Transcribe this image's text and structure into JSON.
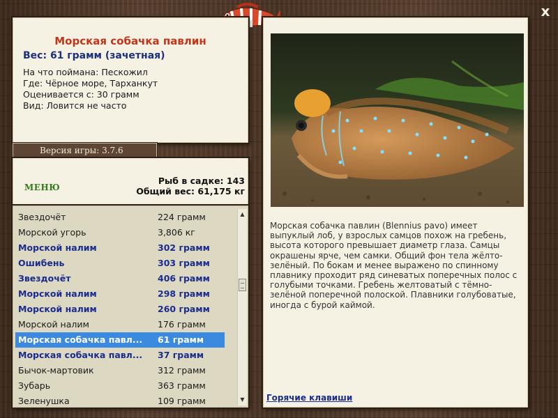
{
  "fish": {
    "name": "Морская собачка павлин",
    "weight_line": "Вес: 61 грамм (зачетная)",
    "bait": "На что поймана: Пескожил",
    "location": "Где: Чёрное море, Тарханкут",
    "rated_from": "Оценивается с: 30 грамм",
    "frequency": "Вид: Ловится не часто"
  },
  "version_label": "Версия игры: 3.7.6",
  "menu_label": "МЕНЮ",
  "cage": {
    "count_line": "Рыб в садке: 143",
    "total_line": "Общий вес: 61,175 кг"
  },
  "list": [
    {
      "name": "Звездочёт",
      "weight": "224 грамм",
      "style": "normal"
    },
    {
      "name": "Морской угорь",
      "weight": "3,806 кг",
      "style": "normal"
    },
    {
      "name": "Морской налим",
      "weight": "302 грамм",
      "style": "bold"
    },
    {
      "name": "Ошибень",
      "weight": "303 грамм",
      "style": "bold"
    },
    {
      "name": "Звездочёт",
      "weight": "406 грамм",
      "style": "bold"
    },
    {
      "name": "Морской налим",
      "weight": "298 грамм",
      "style": "bold"
    },
    {
      "name": "Морской налим",
      "weight": "260 грамм",
      "style": "bold"
    },
    {
      "name": "Морской налим",
      "weight": "176 грамм",
      "style": "normal"
    },
    {
      "name": "Морская собачка павл...",
      "weight": "61 грамм",
      "style": "selected"
    },
    {
      "name": "Морская собачка павл...",
      "weight": "37 грамм",
      "style": "bold"
    },
    {
      "name": "Бычок-мартовик",
      "weight": "312 грамм",
      "style": "normal"
    },
    {
      "name": "Зубарь",
      "weight": "363 грамм",
      "style": "normal"
    },
    {
      "name": "Зеленушка",
      "weight": "109 грамм",
      "style": "normal"
    }
  ],
  "description": "Морская собачка павлин (Blennius pavo) имеет выпуклый лоб, у взрослых самцов похож на гребень, высота которого превышает диаметр глаза. Самцы окрашены ярче, чем самки. Общий фон тела жёлто-зелёный. По бокам и менее выражено по спинному плавнику проходит ряд синеватых поперечных полос с голубыми точками. Гребень желтоватый с тёмно-зелёной поперечной полоской. Плавники голубоватые, иногда с бурой каймой.",
  "hotkeys_label": "Горячие клавиши",
  "close_label": "x",
  "colors": {
    "title": "#c0361c",
    "accent_blue": "#1b2c8f",
    "selection": "#3b8ae0",
    "menu_green": "#3b7a23"
  }
}
